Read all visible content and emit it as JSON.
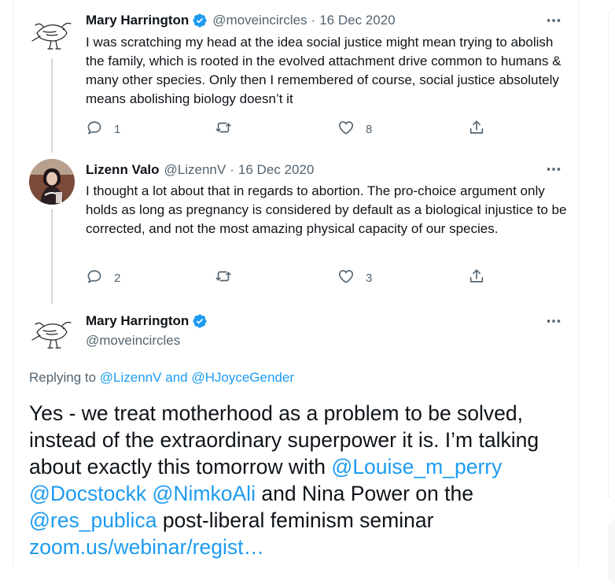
{
  "tweets": [
    {
      "name": "Mary Harrington",
      "handle": "@moveincircles",
      "date": "16 Dec 2020",
      "text": "I was scratching my head at the idea social justice might mean trying to abolish the family, which is rooted in the evolved attachment drive common to humans & many other species. Only then I remembered of course, social justice absolutely means abolishing biology doesn’t it",
      "replies": "1",
      "likes": "8"
    },
    {
      "name": "Lizenn Valo",
      "handle": "@LizennV",
      "date": "16 Dec 2020",
      "text": "I thought a lot about that in regards to abortion. The pro-choice argument only holds as long as pregnancy is considered by default as a biological injustice to be corrected, and not the most amazing physical capacity of our species.",
      "replies": "2",
      "likes": "3"
    }
  ],
  "main_tweet": {
    "name": "Mary Harrington",
    "handle": "@moveincircles",
    "replying_prefix": "Replying to",
    "replying_user1": "@LizennV",
    "replying_and": "and",
    "replying_user2": "@HJoyceGender",
    "text_part1": "Yes - we treat motherhood as a problem to be solved, instead of the extraordinary superpower it is. I’m talking about exactly this tomorrow with",
    "mention1": "@Louise_m_perry",
    "mention2": "@Docstockk",
    "mention3": "@NimkoAli",
    "text_part2": "and Nina Power on the",
    "mention4": "@res_publica",
    "text_part3": "post-liberal feminism seminar",
    "url": "zoom.us/webinar/regist…"
  },
  "colors": {
    "link": "#1d9bf0",
    "muted": "#536471",
    "thread_line": "#cfd9de",
    "verified": "#1d9bf0"
  },
  "icons": [
    "more-icon",
    "reply-icon",
    "retweet-icon",
    "like-icon",
    "share-icon",
    "verified-badge-icon"
  ]
}
